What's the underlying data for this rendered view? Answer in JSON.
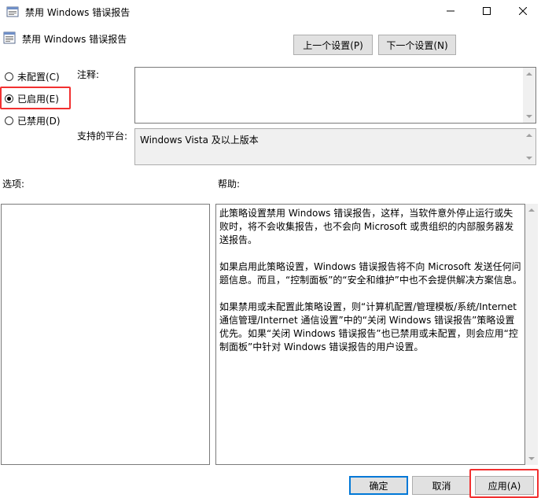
{
  "window": {
    "title": "禁用 Windows 错误报告"
  },
  "header": {
    "policy_title": "禁用 Windows 错误报告",
    "prev_setting": "上一个设置(P)",
    "next_setting": "下一个设置(N)"
  },
  "state": {
    "options": [
      {
        "label": "未配置(C)",
        "selected": false
      },
      {
        "label": "已启用(E)",
        "selected": true
      },
      {
        "label": "已禁用(D)",
        "selected": false
      }
    ]
  },
  "labels": {
    "comment": "注释:",
    "platform": "支持的平台:",
    "options": "选项:",
    "help": "帮助:"
  },
  "fields": {
    "comment_value": "",
    "platform_value": "Windows Vista 及以上版本"
  },
  "help": {
    "paragraphs": [
      "此策略设置禁用 Windows 错误报告，这样，当软件意外停止运行或失败时，将不会收集报告，也不会向 Microsoft 或贵组织的内部服务器发送报告。",
      "如果启用此策略设置，Windows 错误报告将不向 Microsoft 发送任何问题信息。而且，“控制面板”的“安全和维护”中也不会提供解决方案信息。",
      "如果禁用或未配置此策略设置，则“计算机配置/管理模板/系统/Internet 通信管理/Internet 通信设置”中的“关闭 Windows 错误报告”策略设置优先。如果“关闭 Windows 错误报告”也已禁用或未配置，则会应用“控制面板”中针对 Windows 错误报告的用户设置。"
    ]
  },
  "footer": {
    "ok": "确定",
    "cancel": "取消",
    "apply": "应用(A)"
  },
  "colors": {
    "highlight": "#f23030",
    "focus": "#0078d7"
  },
  "icons": {
    "title": "policy-icon",
    "minimize": "minimize-icon",
    "maximize": "maximize-icon",
    "close": "close-icon"
  }
}
